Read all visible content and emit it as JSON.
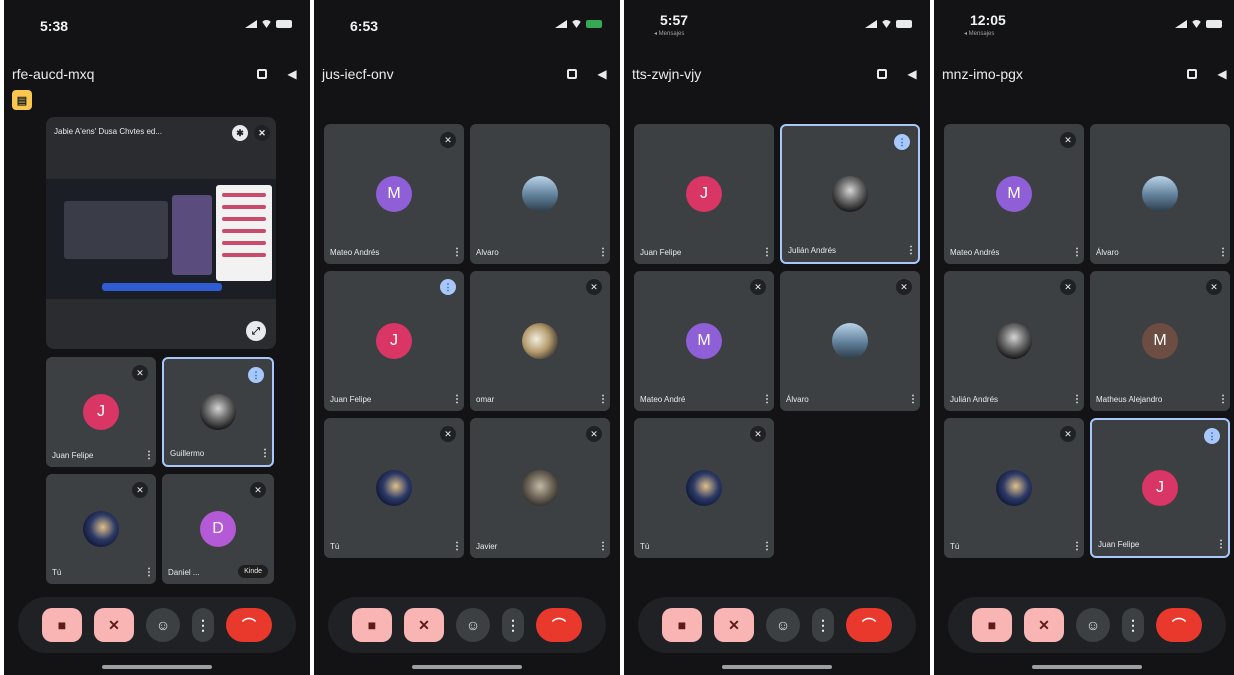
{
  "phones": [
    {
      "status_time": "5:38",
      "meeting_code": "rfe-aucd-mxq",
      "presentation": {
        "title": "Jabie A'ens' Dusa Chvtes ed...",
        "chip": "Kinde"
      },
      "participants": [
        {
          "name": "Juan Felipe",
          "initial": "J"
        },
        {
          "name": "Guillermo",
          "initial": ""
        },
        {
          "name": "Tú",
          "initial": ""
        },
        {
          "name": "Daniel ...",
          "initial": "D"
        }
      ]
    },
    {
      "status_time": "6:53",
      "meeting_code": "jus-iecf-onv",
      "participants": [
        {
          "name": "Mateo Andrés",
          "initial": "M"
        },
        {
          "name": "Alvaro",
          "initial": ""
        },
        {
          "name": "Juan Felipe",
          "initial": "J"
        },
        {
          "name": "omar",
          "initial": ""
        },
        {
          "name": "Tú",
          "initial": ""
        },
        {
          "name": "Javier",
          "initial": ""
        }
      ]
    },
    {
      "status_time": "5:57",
      "status_sub": "◂ Mensajes",
      "meeting_code": "tts-zwjn-vjy",
      "participants": [
        {
          "name": "Juan Felipe",
          "initial": "J"
        },
        {
          "name": "Julián Andrés",
          "initial": ""
        },
        {
          "name": "Mateo André",
          "initial": "M"
        },
        {
          "name": "Álvaro",
          "initial": ""
        },
        {
          "name": "Tú",
          "initial": ""
        }
      ]
    },
    {
      "status_time": "12:05",
      "status_sub": "◂ Mensajes",
      "meeting_code": "mnz-imo-pgx",
      "participants": [
        {
          "name": "Mateo Andrés",
          "initial": "M"
        },
        {
          "name": "Álvaro",
          "initial": ""
        },
        {
          "name": "Julián Andrés",
          "initial": ""
        },
        {
          "name": "Matheus Alejandro",
          "initial": "M"
        },
        {
          "name": "Tú",
          "initial": ""
        },
        {
          "name": "Juan Felipe",
          "initial": "J"
        }
      ]
    }
  ],
  "icons": {
    "bell": "◆",
    "chevron": "▾",
    "speaker": "◀",
    "mic_off": "✕",
    "cam_off": "■",
    "emoji": "☺",
    "more": "⋮",
    "end": "⌒",
    "pin": "✱",
    "expand": "⤢",
    "share": "▤"
  },
  "colors": {
    "background": "#131315",
    "tile": "#3c4043",
    "end_call": "#e9392c",
    "muted_control": "#f9b4b4",
    "active_border": "#a8c7fa"
  }
}
